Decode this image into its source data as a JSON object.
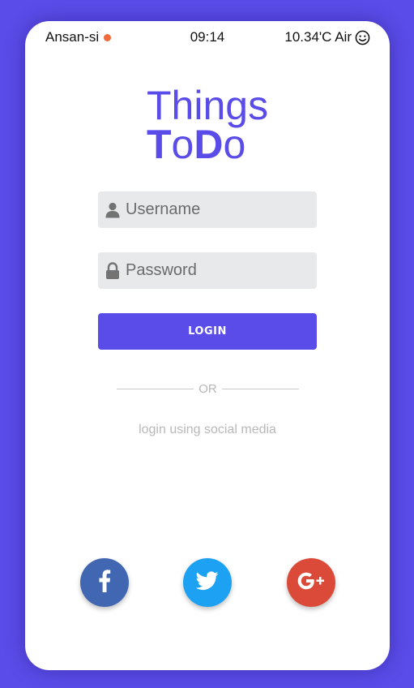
{
  "status_bar": {
    "location": "Ansan-si",
    "time": "09:14",
    "weather": "10.34'C Air",
    "dot_color": "#f06a3c"
  },
  "logo": {
    "line1": "Things",
    "line2_parts": [
      "T",
      "o",
      "D",
      "o"
    ]
  },
  "form": {
    "username_placeholder": "Username",
    "password_placeholder": "Password",
    "login_label": "LOGIN"
  },
  "divider": {
    "text": "OR"
  },
  "social": {
    "caption": "login using social media",
    "buttons": [
      {
        "name": "facebook",
        "icon": "facebook-icon",
        "color": "#4267b2"
      },
      {
        "name": "twitter",
        "icon": "twitter-icon",
        "color": "#1da1f2"
      },
      {
        "name": "google-plus",
        "icon": "google-plus-icon",
        "color": "#db4a39"
      }
    ]
  },
  "colors": {
    "accent": "#5a4ce8",
    "background": "#5a4ce8",
    "card": "#ffffff"
  }
}
